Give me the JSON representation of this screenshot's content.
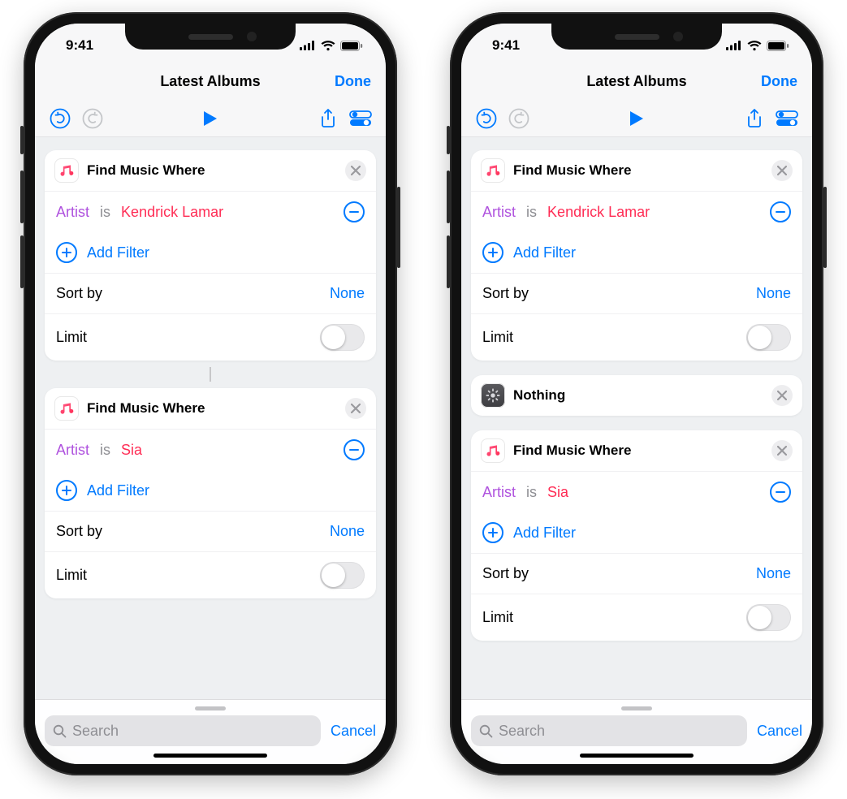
{
  "status": {
    "time": "9:41"
  },
  "nav": {
    "title": "Latest Albums",
    "done": "Done"
  },
  "labels": {
    "add_filter": "Add Filter",
    "sort_by": "Sort by",
    "limit": "Limit",
    "none": "None",
    "search_placeholder": "Search",
    "cancel": "Cancel"
  },
  "filter": {
    "field": "Artist",
    "op": "is"
  },
  "phones": {
    "left": {
      "cards": [
        {
          "title": "Find Music Where",
          "value": "Kendrick Lamar"
        },
        {
          "title": "Find Music Where",
          "value": "Sia"
        }
      ]
    },
    "right": {
      "cards": [
        {
          "title": "Find Music Where",
          "value": "Kendrick Lamar"
        },
        {
          "type": "nothing",
          "title": "Nothing"
        },
        {
          "title": "Find Music Where",
          "value": "Sia"
        }
      ]
    }
  }
}
